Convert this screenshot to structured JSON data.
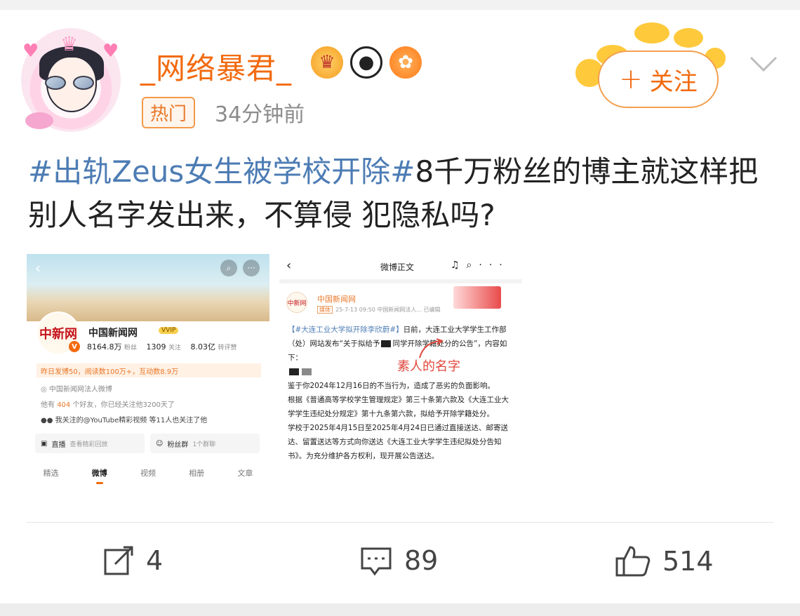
{
  "post": {
    "username": "_网络暴君_",
    "hot_tag": "热门",
    "time": "34分钟前",
    "follow_label": "关注",
    "text_topic": "#出轨Zeus女生被学校开除#",
    "text_body": "8千万粉丝的博主就这样把别人名字发出来，不算侵 犯隐私吗?"
  },
  "badges": [
    "crown-icon",
    "panda-icon",
    "fish-icon"
  ],
  "shot_left": {
    "name": "中国新闻网",
    "vip": "VVIP",
    "logo_text": "中新网",
    "fans_num": "8164.8万",
    "fans_label": "粉丝",
    "follow_num": "1309",
    "follow_label": "关注",
    "likes_num": "8.03亿",
    "likes_label": "转评赞",
    "highlight": "昨日发博50，阅读数100万+，互动数8.9万",
    "verified": "中国新闻网法人微博",
    "friends_pre": "他有",
    "friends_num": "404",
    "friends_post": "个好友，你已经关注他3200天了",
    "mutual": "我关注的@YouTube精彩视频 等11人也关注了他",
    "live_label": "直播",
    "live_sub": "查看精彩回放",
    "fans_group_label": "粉丝群",
    "fans_group_sub": "1个群聊",
    "tabs": [
      "精选",
      "微博",
      "视频",
      "相册",
      "文章"
    ]
  },
  "shot_right": {
    "title": "微博正文",
    "name": "中国新闻网",
    "tag": "媒体",
    "meta": "25-7-13 09:50  中国新闻网法人...  已编辑",
    "topic": "【#大连工业大学拟开除李欣蔚#】",
    "para1": "日前，大连工业大学学生工作部（处）网站发布“关于拟给予",
    "para1b": "同学开除学籍处分的公告”，内容如下：",
    "para2": "鉴于你2024年12月16日的不当行为，造成了恶劣的负面影响。",
    "para3": "根据《普通高等学校学生管理规定》第三十条第六款及《大连工业大学学生违纪处分规定》第十九条第六款，拟给予开除学籍处分。",
    "para4": "学校于2025年4月15日至2025年4月24日已通过直接送达、邮寄送达、留置送达等方式向你送达《大连工业大学学生违纪拟处分告知书》。为充分维护各方权利，现开展公告送达。",
    "annotation": "素人的名字"
  },
  "actions": {
    "share_count": "4",
    "comment_count": "89",
    "like_count": "514"
  },
  "colors": {
    "accent": "#f26a0f",
    "topic": "#4d7cb4",
    "annotation": "#e0483c"
  }
}
